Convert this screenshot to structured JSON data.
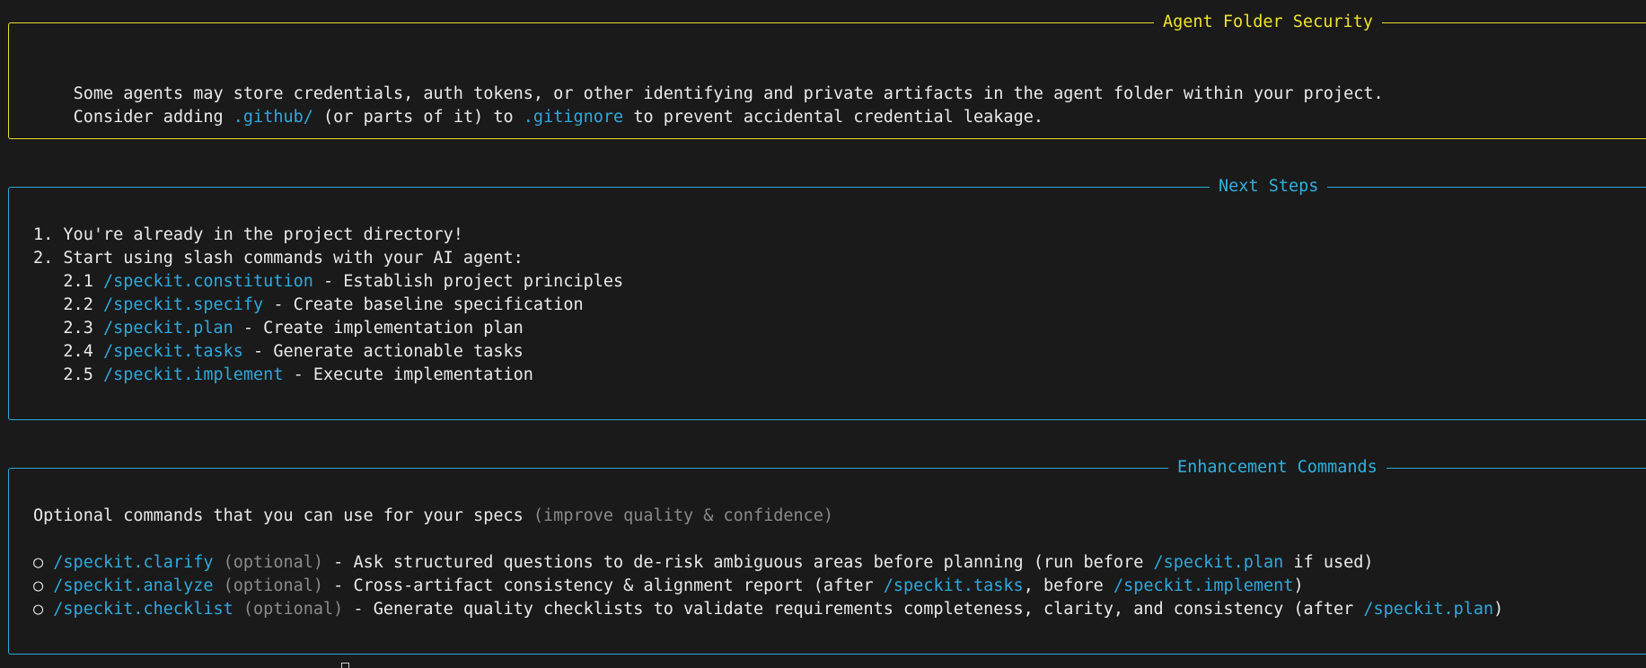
{
  "security": {
    "title": "Agent Folder Security",
    "line1": "Some agents may store credentials, auth tokens, or other identifying and private artifacts in the agent folder within your project.",
    "line2_prefix": "Consider adding ",
    "line2_path": ".github/",
    "line2_mid": " (or parts of it) to ",
    "line2_file": ".gitignore",
    "line2_suffix": " to prevent accidental credential leakage."
  },
  "next_steps": {
    "title": "Next Steps",
    "step1": "1. You're already in the project directory!",
    "step2": "2. Start using slash commands with your AI agent:",
    "substeps": [
      {
        "num": "   2.1 ",
        "cmd": "/speckit.constitution",
        "desc": " - Establish project principles"
      },
      {
        "num": "   2.2 ",
        "cmd": "/speckit.specify",
        "desc": " - Create baseline specification"
      },
      {
        "num": "   2.3 ",
        "cmd": "/speckit.plan",
        "desc": " - Create implementation plan"
      },
      {
        "num": "   2.4 ",
        "cmd": "/speckit.tasks",
        "desc": " - Generate actionable tasks"
      },
      {
        "num": "   2.5 ",
        "cmd": "/speckit.implement",
        "desc": " - Execute implementation"
      }
    ]
  },
  "enhancement": {
    "title": "Enhancement Commands",
    "intro": "Optional commands that you can use for your specs ",
    "intro_dim": "(improve quality & confidence)",
    "bullet": "○ ",
    "optional_label": " (optional)",
    "items": [
      {
        "cmd": "/speckit.clarify",
        "desc1": " - Ask structured questions to de-risk ambiguous areas before planning (run before ",
        "ref1": "/speckit.plan",
        "desc2": " if used)",
        "ref2": "",
        "desc3": ""
      },
      {
        "cmd": "/speckit.analyze",
        "desc1": " - Cross-artifact consistency & alignment report (after ",
        "ref1": "/speckit.tasks",
        "desc2": ", before ",
        "ref2": "/speckit.implement",
        "desc3": ")"
      },
      {
        "cmd": "/speckit.checklist",
        "desc1": " - Generate quality checklists to validate requirements completeness, clarity, and consistency (after ",
        "ref1": "/speckit.plan",
        "desc2": ")",
        "ref2": "",
        "desc3": ""
      }
    ]
  },
  "colors": {
    "background": "#1a1a1a",
    "text": "#eaeaea",
    "yellow": "#f0e22c",
    "blue": "#2fa8dc",
    "dim": "#8a8a8a"
  }
}
